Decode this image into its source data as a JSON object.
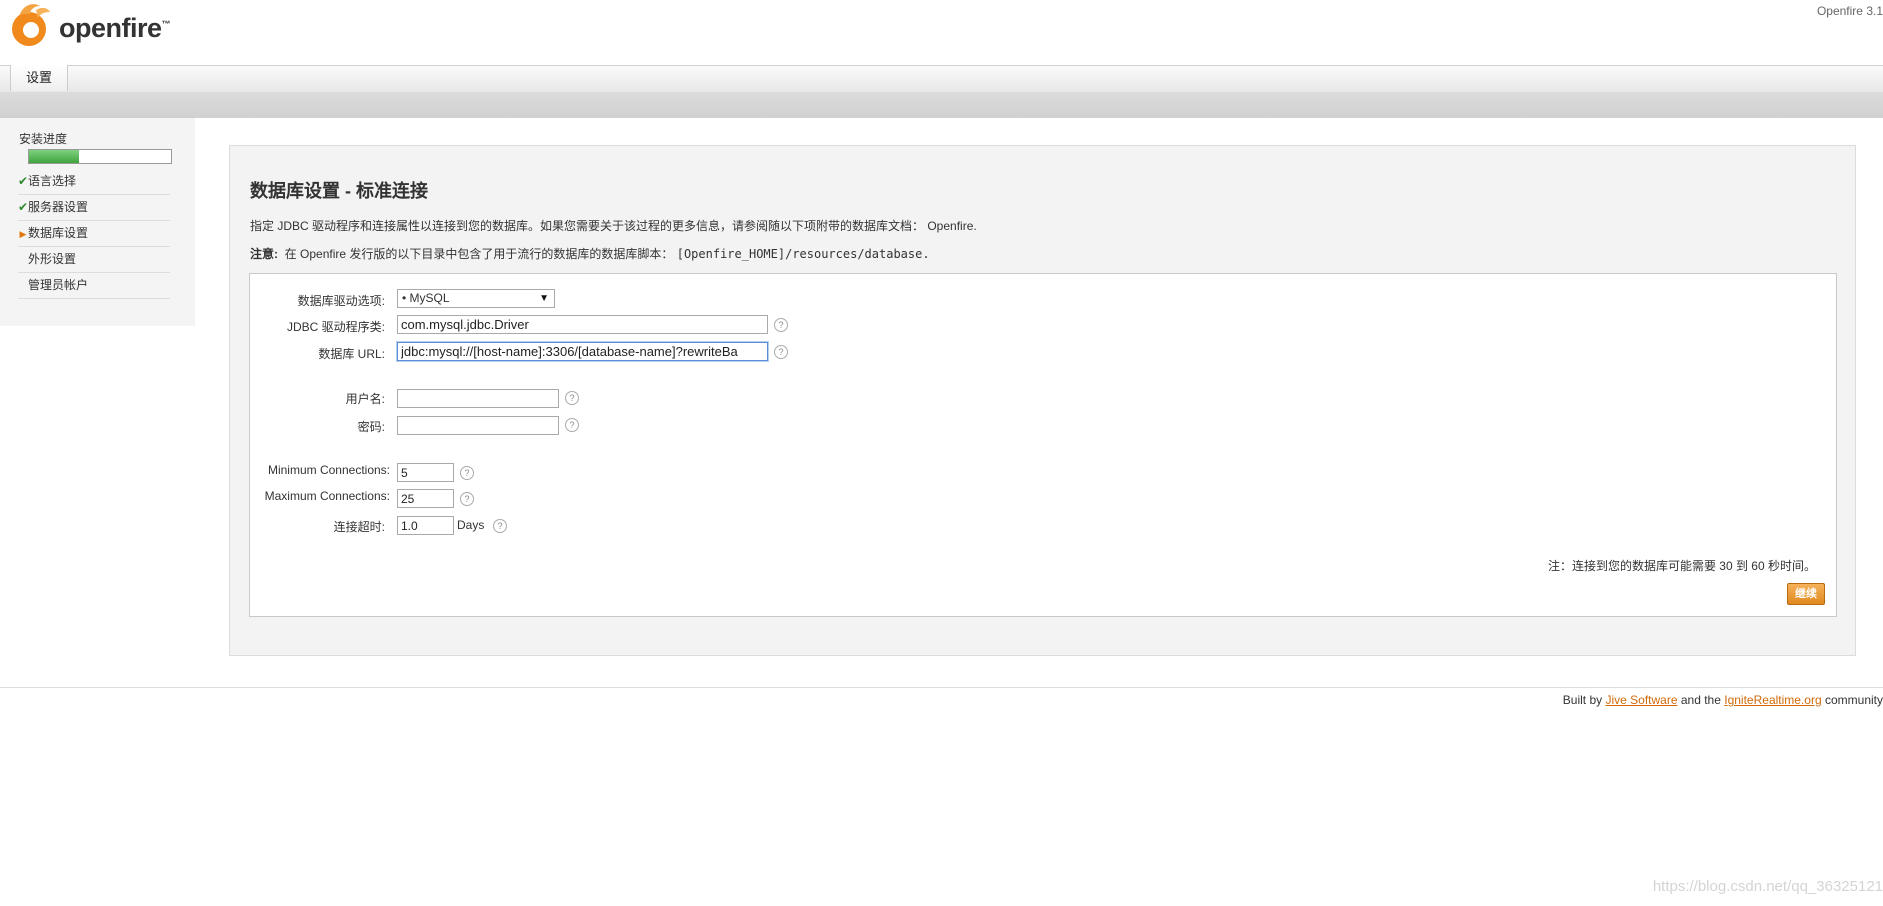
{
  "header": {
    "logo_text": "openfire",
    "logo_tm": "™",
    "version": "Openfire 3.1"
  },
  "tabs": [
    {
      "label": "设置"
    }
  ],
  "sidebar": {
    "progress_label": "安装进度",
    "progress_fraction": 0.35,
    "items": [
      {
        "label": "语言选择",
        "state": "done"
      },
      {
        "label": "服务器设置",
        "state": "done"
      },
      {
        "label": "数据库设置",
        "state": "current"
      },
      {
        "label": "外形设置",
        "state": "pending"
      },
      {
        "label": "管理员帐户",
        "state": "pending"
      }
    ]
  },
  "main": {
    "title": "数据库设置 - 标准连接",
    "description": "指定 JDBC 驱动程序和连接属性以连接到您的数据库。如果您需要关于该过程的更多信息，请参阅随以下项附带的数据库文档： Openfire.",
    "note_label": "注意:",
    "note_text": "在 Openfire 发行版的以下目录中包含了用于流行的数据库的数据库脚本：",
    "note_path": "[Openfire_HOME]/resources/database."
  },
  "form": {
    "driver_label": "数据库驱动选项:",
    "driver_value": "• MySQL",
    "jdbc_label": "JDBC 驱动程序类:",
    "jdbc_value": "com.mysql.jdbc.Driver",
    "url_label": "数据库 URL:",
    "url_value": "jdbc:mysql://[host-name]:3306/[database-name]?rewriteBa",
    "user_label": "用户名:",
    "user_value": "",
    "password_label": "密码:",
    "password_value": "",
    "min_label": "Minimum Connections:",
    "min_value": "5",
    "max_label": "Maximum Connections:",
    "max_value": "25",
    "timeout_label": "连接超时:",
    "timeout_value": "1.0",
    "timeout_unit": "Days",
    "help_glyph": "?",
    "connect_note": "注：连接到您的数据库可能需要 30 到 60 秒时间。",
    "continue_label": "继续"
  },
  "footer": {
    "built_by": "Built by",
    "jive": "Jive Software",
    "and_the": "and the",
    "ignite": "IgniteRealtime.org",
    "community": "community"
  },
  "watermark": "https://blog.csdn.net/qq_36325121",
  "colors": {
    "accent_orange": "#e08a1e",
    "link_orange": "#d16a0a",
    "progress_green": "#3fa43f"
  }
}
